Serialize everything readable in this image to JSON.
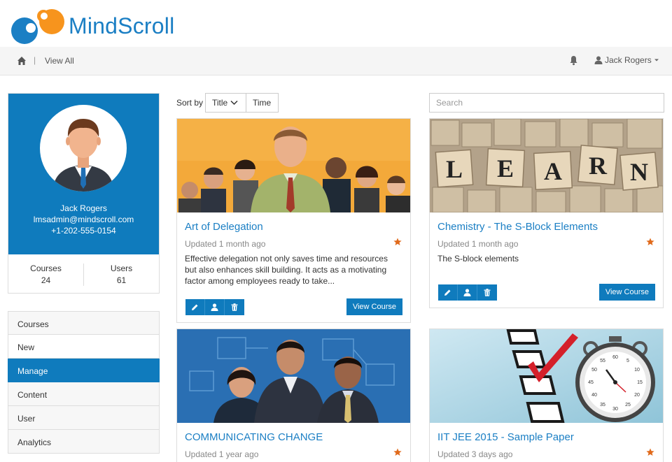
{
  "brand": {
    "name": "MindScroll",
    "primary": "#0f7bbd",
    "accent": "#f7941d"
  },
  "navbar": {
    "view_all": "View All",
    "separator": "|",
    "user_name": "Jack Rogers"
  },
  "profile": {
    "name": "Jack Rogers",
    "email": "lmsadmin@mindscroll.com",
    "phone": "+1-202-555-0154",
    "stats": [
      {
        "label": "Courses",
        "value": "24"
      },
      {
        "label": "Users",
        "value": "61"
      }
    ]
  },
  "sidenav": {
    "items": [
      {
        "label": "Courses"
      },
      {
        "label": "New"
      },
      {
        "label": "Manage"
      },
      {
        "label": "Content"
      },
      {
        "label": "User"
      },
      {
        "label": "Analytics"
      }
    ]
  },
  "sort": {
    "label": "Sort by",
    "title": "Title",
    "time": "Time"
  },
  "search": {
    "placeholder": "Search"
  },
  "view_course_label": "View Course",
  "cards": [
    {
      "title": "Art of Delegation",
      "updated": "Updated 1 month ago",
      "description": "Effective delegation not only saves time and resources but also enhances skill building. It acts as a motivating factor among employees ready to take..."
    },
    {
      "title": "Chemistry - The S-Block Elements",
      "updated": "Updated 1 month ago",
      "description": "The S-block elements",
      "image_letters": [
        "L",
        "E",
        "A",
        "R",
        "N"
      ]
    },
    {
      "title": "COMMUNICATING CHANGE",
      "updated": "Updated 1 year ago"
    },
    {
      "title": "IIT JEE 2015 - Sample Paper",
      "updated": "Updated 3 days ago",
      "image_numbers": [
        "60",
        "55",
        "5",
        "10",
        "50",
        "15",
        "45",
        "20",
        "40",
        "25",
        "35",
        "30"
      ]
    }
  ]
}
